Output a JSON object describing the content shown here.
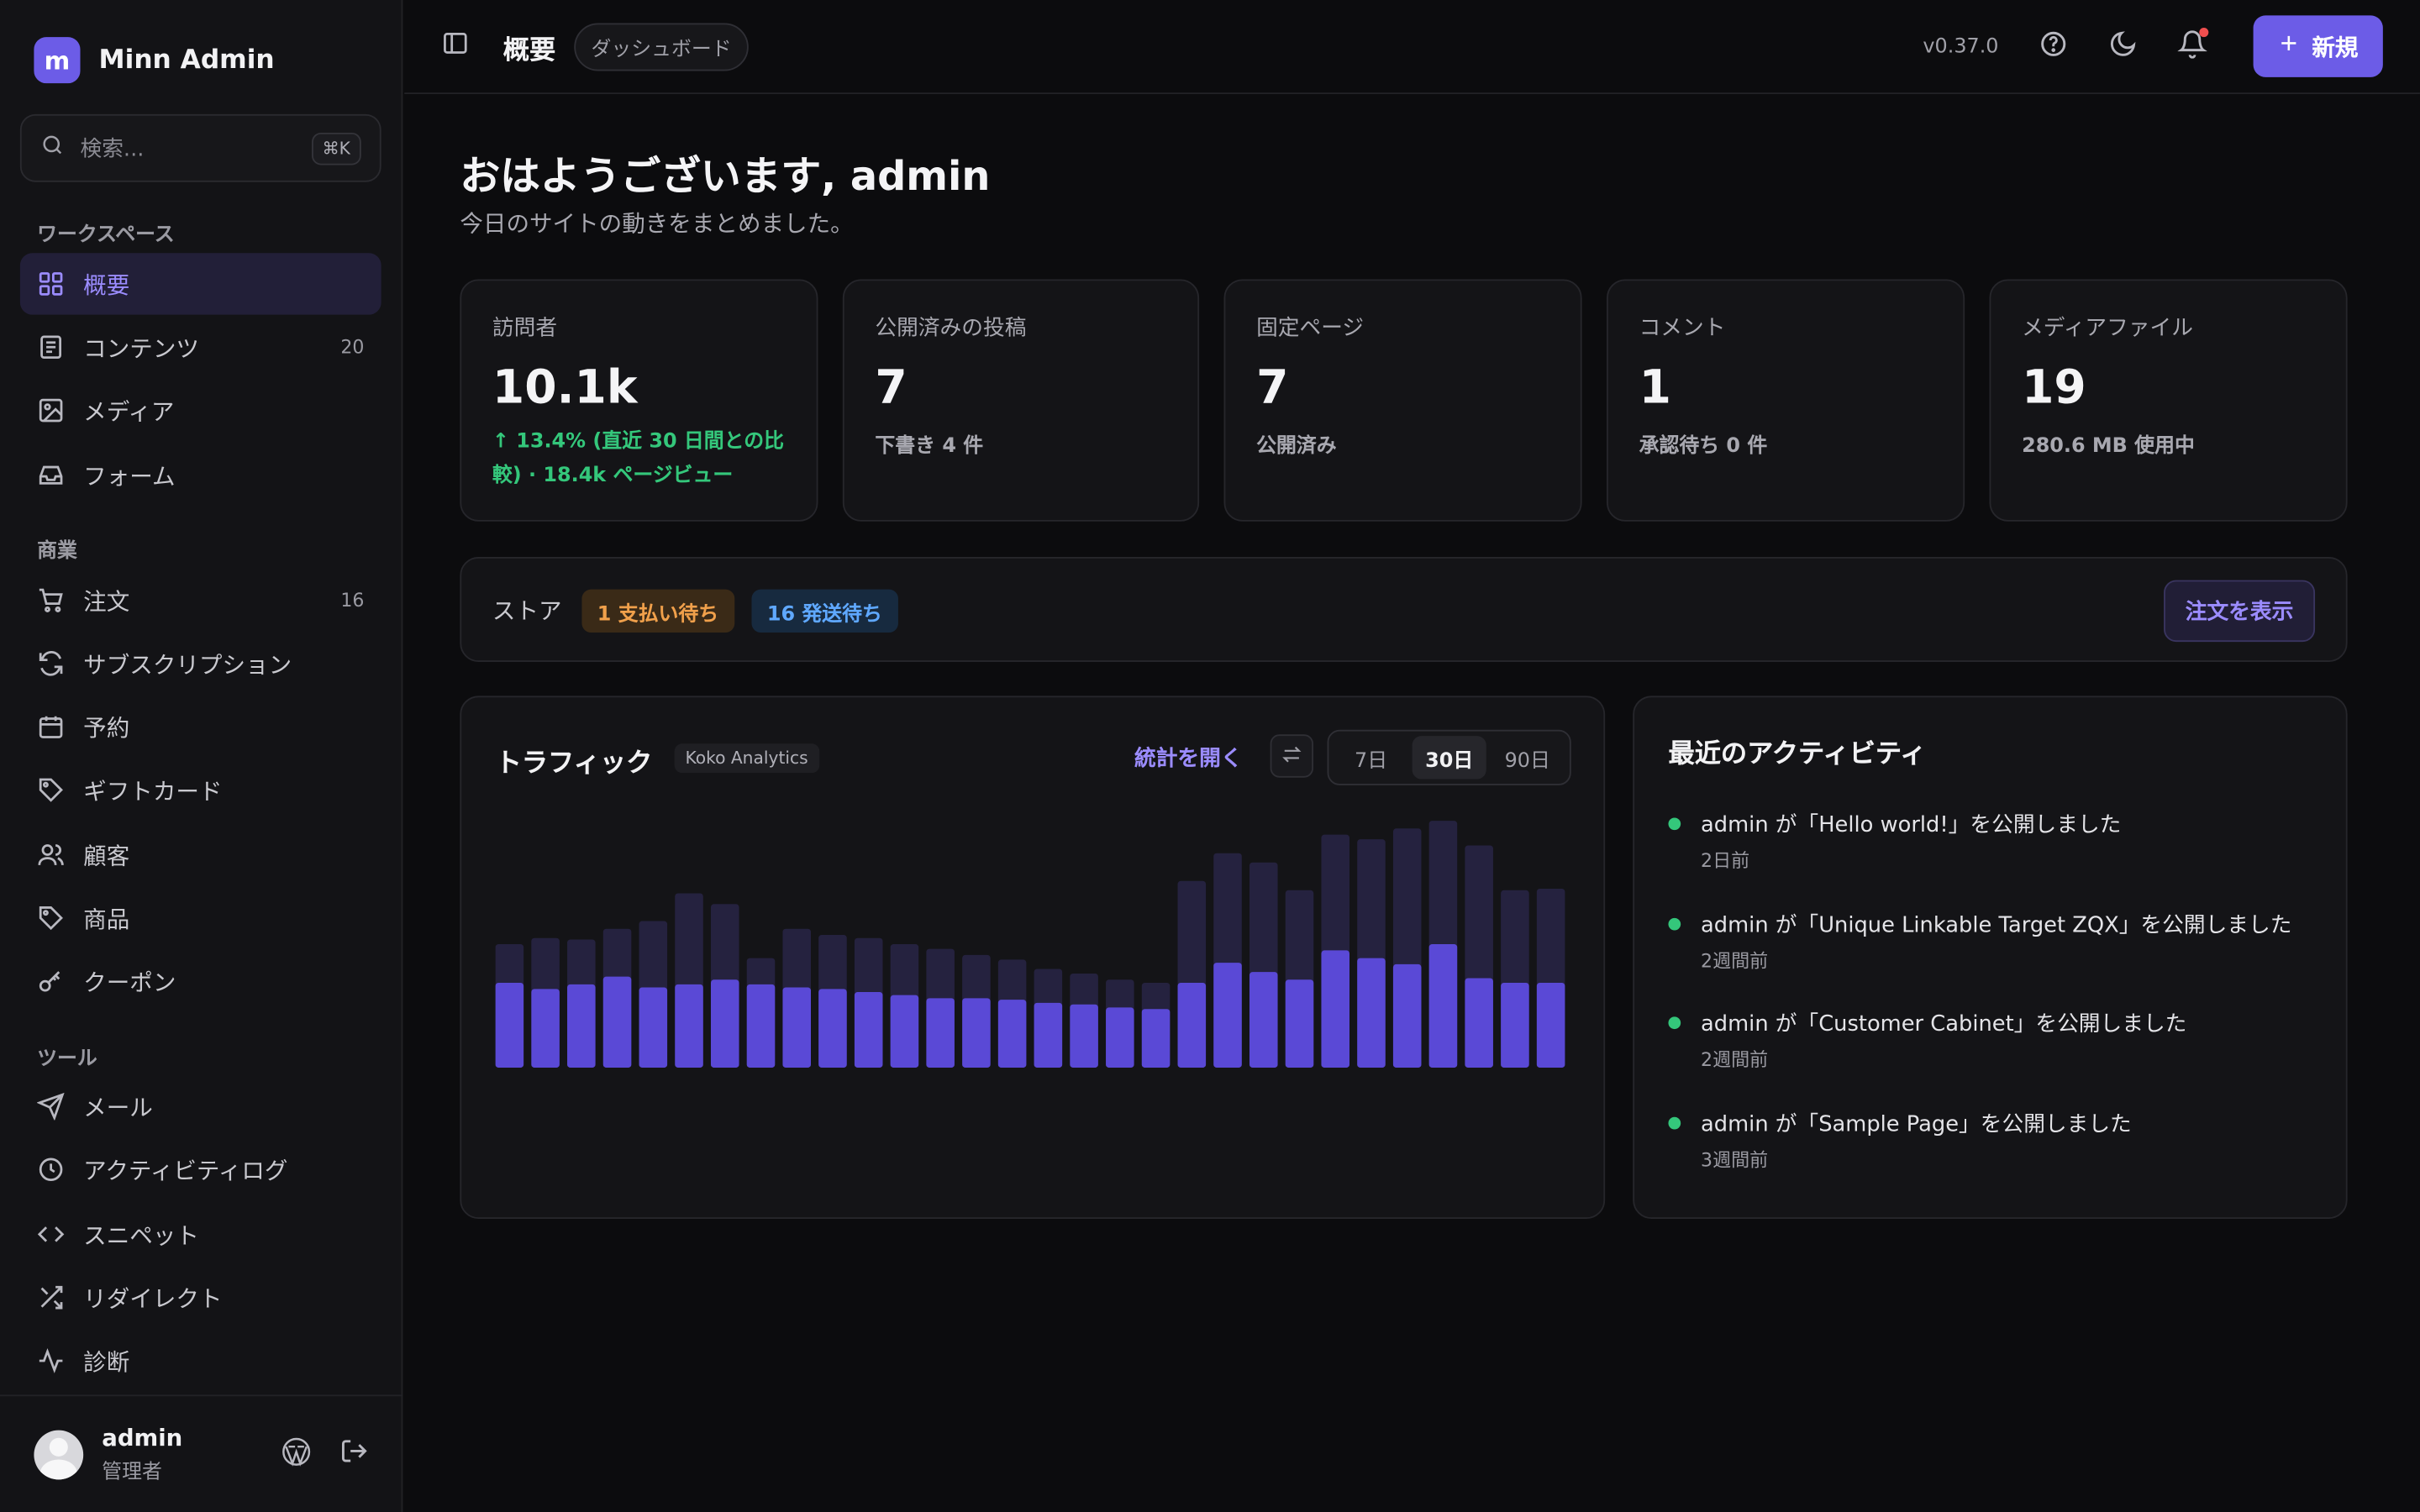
{
  "brand": {
    "initial": "m",
    "name": "Minn Admin"
  },
  "search": {
    "placeholder": "検索...",
    "shortcut": "⌘K"
  },
  "sidebar": {
    "sections": [
      {
        "label": "ワークスペース"
      },
      {
        "label": "商業"
      },
      {
        "label": "ツール"
      }
    ],
    "items": [
      {
        "label": "概要",
        "icon": "grid-icon",
        "active": true
      },
      {
        "label": "コンテンツ",
        "icon": "document-icon",
        "count": "20"
      },
      {
        "label": "メディア",
        "icon": "image-icon"
      },
      {
        "label": "フォーム",
        "icon": "inbox-icon"
      },
      {
        "label": "注文",
        "icon": "cart-icon",
        "count": "16"
      },
      {
        "label": "サブスクリプション",
        "icon": "refresh-icon"
      },
      {
        "label": "予約",
        "icon": "calendar-icon"
      },
      {
        "label": "ギフトカード",
        "icon": "tag-icon"
      },
      {
        "label": "顧客",
        "icon": "users-icon"
      },
      {
        "label": "商品",
        "icon": "tag-icon"
      },
      {
        "label": "クーポン",
        "icon": "key-icon"
      },
      {
        "label": "メール",
        "icon": "send-icon"
      },
      {
        "label": "アクティビティログ",
        "icon": "clock-icon"
      },
      {
        "label": "スニペット",
        "icon": "code-icon"
      },
      {
        "label": "リダイレクト",
        "icon": "shuffle-icon"
      },
      {
        "label": "診断",
        "icon": "pulse-icon"
      }
    ]
  },
  "user": {
    "name": "admin",
    "role": "管理者"
  },
  "header": {
    "title": "概要",
    "breadcrumb": "ダッシュボード",
    "version": "v0.37.0",
    "new_label": "新規"
  },
  "greeting": {
    "title": "おはようございます, admin",
    "subtitle": "今日のサイトの動きをまとめました。"
  },
  "stats": [
    {
      "label": "訪問者",
      "value": "10.1k",
      "sub": "↑ 13.4% (直近 30 日間との比較) · 18.4k ページビュー"
    },
    {
      "label": "公開済みの投稿",
      "value": "7",
      "sub": "下書き 4 件"
    },
    {
      "label": "固定ページ",
      "value": "7",
      "sub": "公開済み"
    },
    {
      "label": "コメント",
      "value": "1",
      "sub": "承認待ち 0 件"
    },
    {
      "label": "メディアファイル",
      "value": "19",
      "sub": "280.6 MB 使用中"
    }
  ],
  "store": {
    "label": "ストア",
    "badge_pending_payment": "1 支払い待ち",
    "badge_pending_shipping": "16 発送待ち",
    "view_orders": "注文を表示"
  },
  "traffic": {
    "title": "トラフィック",
    "tag": "Koko Analytics",
    "open_stats": "統計を開く",
    "ranges": [
      "7日",
      "30日",
      "90日"
    ],
    "active_range": "30日"
  },
  "chart_data": {
    "type": "bar",
    "series": [
      {
        "values": [
          80,
          84,
          83,
          90,
          95,
          113,
          106,
          71,
          90,
          86,
          84,
          80,
          77,
          73,
          70,
          64,
          61,
          57,
          55,
          121,
          139,
          133,
          115,
          151,
          148,
          155,
          160,
          144,
          115,
          116
        ]
      },
      {
        "values": [
          55,
          51,
          54,
          59,
          52,
          54,
          57,
          54,
          52,
          51,
          49,
          47,
          45,
          45,
          44,
          42,
          41,
          39,
          38,
          55,
          68,
          62,
          57,
          76,
          71,
          67,
          80,
          58,
          55,
          55
        ]
      }
    ],
    "colors": [
      "#25223f",
      "#5a49d6"
    ],
    "grid": false,
    "legend": "none"
  },
  "activity": {
    "title": "最近のアクティビティ",
    "items": [
      {
        "text": "admin が「Hello world!」を公開しました",
        "time": "2日前"
      },
      {
        "text": "admin が「Unique Linkable Target ZQX」を公開しました",
        "time": "2週間前"
      },
      {
        "text": "admin が「Customer Cabinet」を公開しました",
        "time": "2週間前"
      },
      {
        "text": "admin が「Sample Page」を公開しました",
        "time": "3週間前"
      }
    ]
  }
}
